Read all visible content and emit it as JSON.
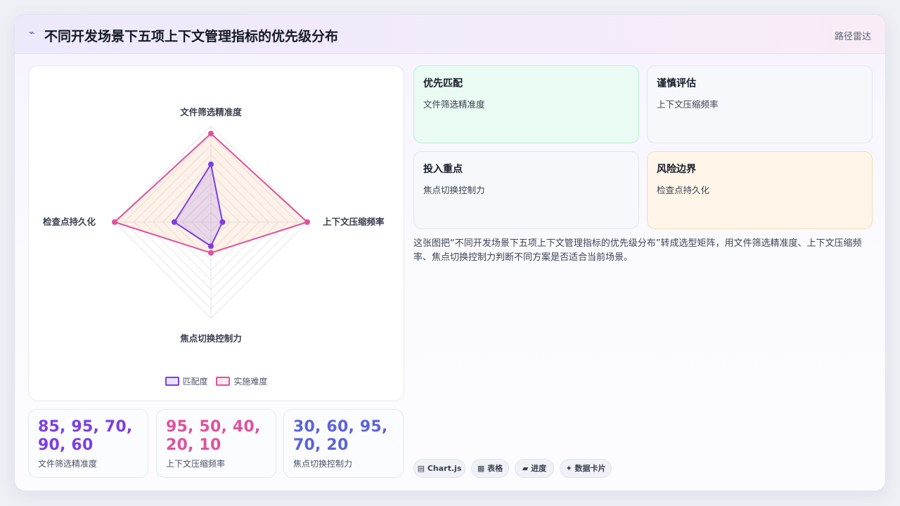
{
  "header": {
    "title": "不同开发场景下五项上下文管理指标的优先级分布",
    "tag": "路径雷达"
  },
  "chart_data": {
    "type": "radar",
    "axes": [
      "文件筛选精准度",
      "上下文压缩频率",
      "焦点切换控制力",
      "检查点持久化"
    ],
    "range": [
      0,
      100
    ],
    "grid": true,
    "legend_position": "bottom",
    "series": [
      {
        "name": "匹配度",
        "values": [
          60,
          12,
          25,
          38
        ],
        "color": "#7b3fe4"
      },
      {
        "name": "实施难度",
        "values": [
          92,
          100,
          32,
          100
        ],
        "color": "#e0529c"
      }
    ]
  },
  "stats": [
    {
      "value": "85, 95, 70, 90, 60",
      "label": "文件筛选精准度",
      "color": "#7b3fe4"
    },
    {
      "value": "95, 50, 40, 20, 10",
      "label": "上下文压缩频率",
      "color": "#e0529c"
    },
    {
      "value": "30, 60, 95, 70, 20",
      "label": "焦点切换控制力",
      "color": "#5b63dc"
    }
  ],
  "quadrants": [
    {
      "title": "优先匹配",
      "item": "文件筛选精准度",
      "bg": "#e9fbf2",
      "border": "#bfeed7"
    },
    {
      "title": "谨慎评估",
      "item": "上下文压缩频率",
      "bg": "#f7f8fc",
      "border": "#e3e6ef"
    },
    {
      "title": "投入重点",
      "item": "焦点切换控制力",
      "bg": "#f7f8fc",
      "border": "#e3e6ef"
    },
    {
      "title": "风险边界",
      "item": "检查点持久化",
      "bg": "#fff6e9",
      "border": "#f6dcb0"
    }
  ],
  "description": "这张图把“不同开发场景下五项上下文管理指标的优先级分布”转成选型矩阵，用文件筛选精准度、上下文压缩频率、焦点切换控制力判断不同方案是否适合当前场景。",
  "pills": [
    {
      "icon": "▤",
      "label": "Chart.js"
    },
    {
      "icon": "▦",
      "label": "表格"
    },
    {
      "icon": "▰",
      "label": "进度"
    },
    {
      "icon": "✦",
      "label": "数据卡片"
    }
  ]
}
